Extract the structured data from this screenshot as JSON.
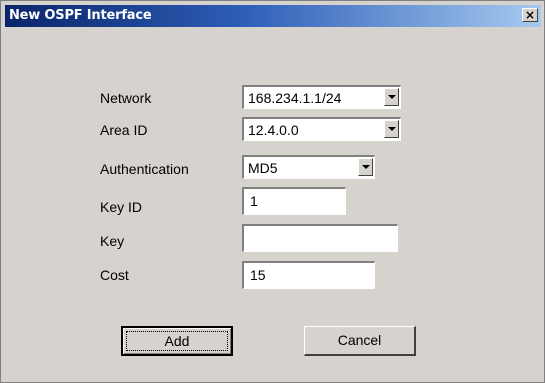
{
  "window": {
    "title": "New OSPF Interface",
    "close_glyph": "×"
  },
  "form": {
    "network": {
      "label": "Network",
      "value": "168.234.1.1/24"
    },
    "area_id": {
      "label": "Area ID",
      "value": "12.4.0.0"
    },
    "authentication": {
      "label": "Authentication",
      "value": "MD5"
    },
    "key_id": {
      "label": "Key ID",
      "value": "1"
    },
    "key": {
      "label": "Key",
      "value": ""
    },
    "cost": {
      "label": "Cost",
      "value": "15"
    }
  },
  "buttons": {
    "add": "Add",
    "cancel": "Cancel"
  },
  "colors": {
    "dialog_bg": "#d6d3ce",
    "title_start": "#0a246a",
    "title_end": "#a6caf0"
  },
  "icons": {
    "close": "close-icon",
    "dropdown": "chevron-down-icon"
  }
}
